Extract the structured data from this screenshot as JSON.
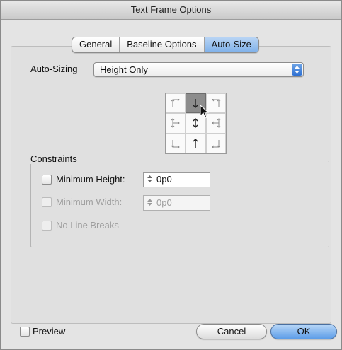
{
  "window": {
    "title": "Text Frame Options"
  },
  "tabs": [
    {
      "label": "General",
      "active": false
    },
    {
      "label": "Baseline Options",
      "active": false
    },
    {
      "label": "Auto-Size",
      "active": true
    }
  ],
  "auto_sizing": {
    "label": "Auto-Sizing",
    "value": "Height Only"
  },
  "reference_grid": {
    "selected_cell": "top-center"
  },
  "constraints": {
    "legend": "Constraints",
    "minimum_height": {
      "label": "Minimum Height:",
      "value": "0p0",
      "checked": false,
      "enabled": true
    },
    "minimum_width": {
      "label": "Minimum Width:",
      "value": "0p0",
      "checked": false,
      "enabled": false
    },
    "no_line_breaks": {
      "label": "No Line Breaks",
      "checked": false,
      "enabled": false
    }
  },
  "footer": {
    "preview_label": "Preview",
    "cancel_label": "Cancel",
    "ok_label": "OK"
  },
  "colors": {
    "accent": "#5d9de8",
    "panel": "#e0e0e0",
    "window": "#e4e4e4"
  },
  "icons": [
    "chevron-updown-icon",
    "stepper-icon",
    "mouse-cursor-icon",
    "reference-point-icon"
  ]
}
